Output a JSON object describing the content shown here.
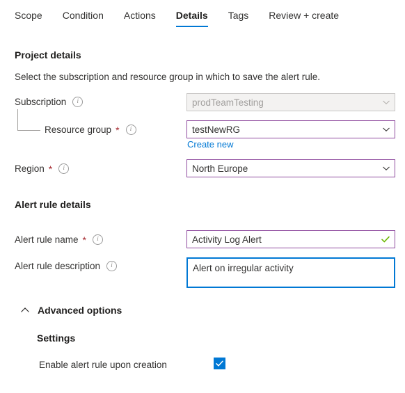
{
  "tabs": [
    {
      "label": "Scope",
      "active": false
    },
    {
      "label": "Condition",
      "active": false
    },
    {
      "label": "Actions",
      "active": false
    },
    {
      "label": "Details",
      "active": true
    },
    {
      "label": "Tags",
      "active": false
    },
    {
      "label": "Review + create",
      "active": false
    }
  ],
  "project_details": {
    "title": "Project details",
    "description": "Select the subscription and resource group in which to save the alert rule.",
    "subscription": {
      "label": "Subscription",
      "value": "prodTeamTesting",
      "disabled": true,
      "required": false,
      "icon": "info-icon",
      "chevron": "chevron-down-icon"
    },
    "resource_group": {
      "label": "Resource group",
      "value": "testNewRG",
      "disabled": false,
      "required": true,
      "icon": "info-icon",
      "chevron": "chevron-down-icon",
      "create_new_link": "Create new"
    },
    "region": {
      "label": "Region",
      "value": "North Europe",
      "disabled": false,
      "required": true,
      "icon": "info-icon",
      "chevron": "chevron-down-icon"
    }
  },
  "alert_rule_details": {
    "title": "Alert rule details",
    "name": {
      "label": "Alert rule name",
      "value": "Activity Log Alert",
      "required": true,
      "icon": "info-icon",
      "validation_icon": "checkmark-valid-icon"
    },
    "description": {
      "label": "Alert rule description",
      "value": "Alert on irregular activity",
      "required": false,
      "icon": "info-icon"
    }
  },
  "advanced_options": {
    "label": "Advanced options",
    "expanded": true,
    "chevron": "chevron-up-icon",
    "settings_title": "Settings",
    "enable_rule": {
      "label": "Enable alert rule upon creation",
      "checked": true,
      "icon": "checkbox-checked-icon"
    }
  },
  "colors": {
    "accent_blue": "#0078d4",
    "field_border_purple": "#8e4a9e",
    "required_red": "#a4262c",
    "valid_green": "#6bb700",
    "disabled_bg": "#f3f2f1",
    "text": "#323130"
  }
}
